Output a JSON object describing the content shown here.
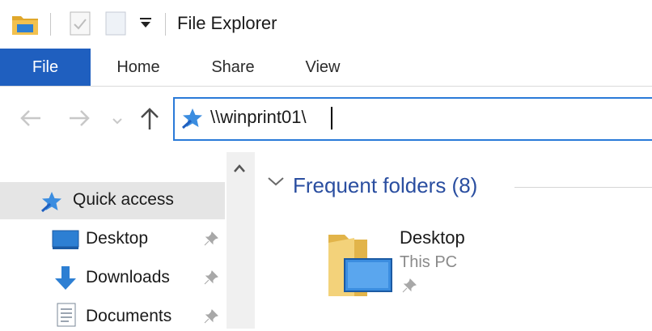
{
  "window": {
    "title": "File Explorer"
  },
  "ribbon": {
    "tabs": [
      "File",
      "Home",
      "Share",
      "View"
    ]
  },
  "address": {
    "value": "\\\\winprint01\\"
  },
  "nav": {
    "items": [
      {
        "label": "Quick access",
        "icon": "quick-access-star-icon"
      },
      {
        "label": "Desktop",
        "icon": "desktop-icon"
      },
      {
        "label": "Downloads",
        "icon": "downloads-arrow-icon"
      },
      {
        "label": "Documents",
        "icon": "documents-icon"
      }
    ]
  },
  "content": {
    "group_title": "Frequent folders (8)",
    "items": [
      {
        "name": "Desktop",
        "location": "This PC"
      }
    ]
  },
  "colors": {
    "accent": "#1f5fbf",
    "link": "#2a4ea0",
    "border_focus": "#2a7ad8"
  }
}
